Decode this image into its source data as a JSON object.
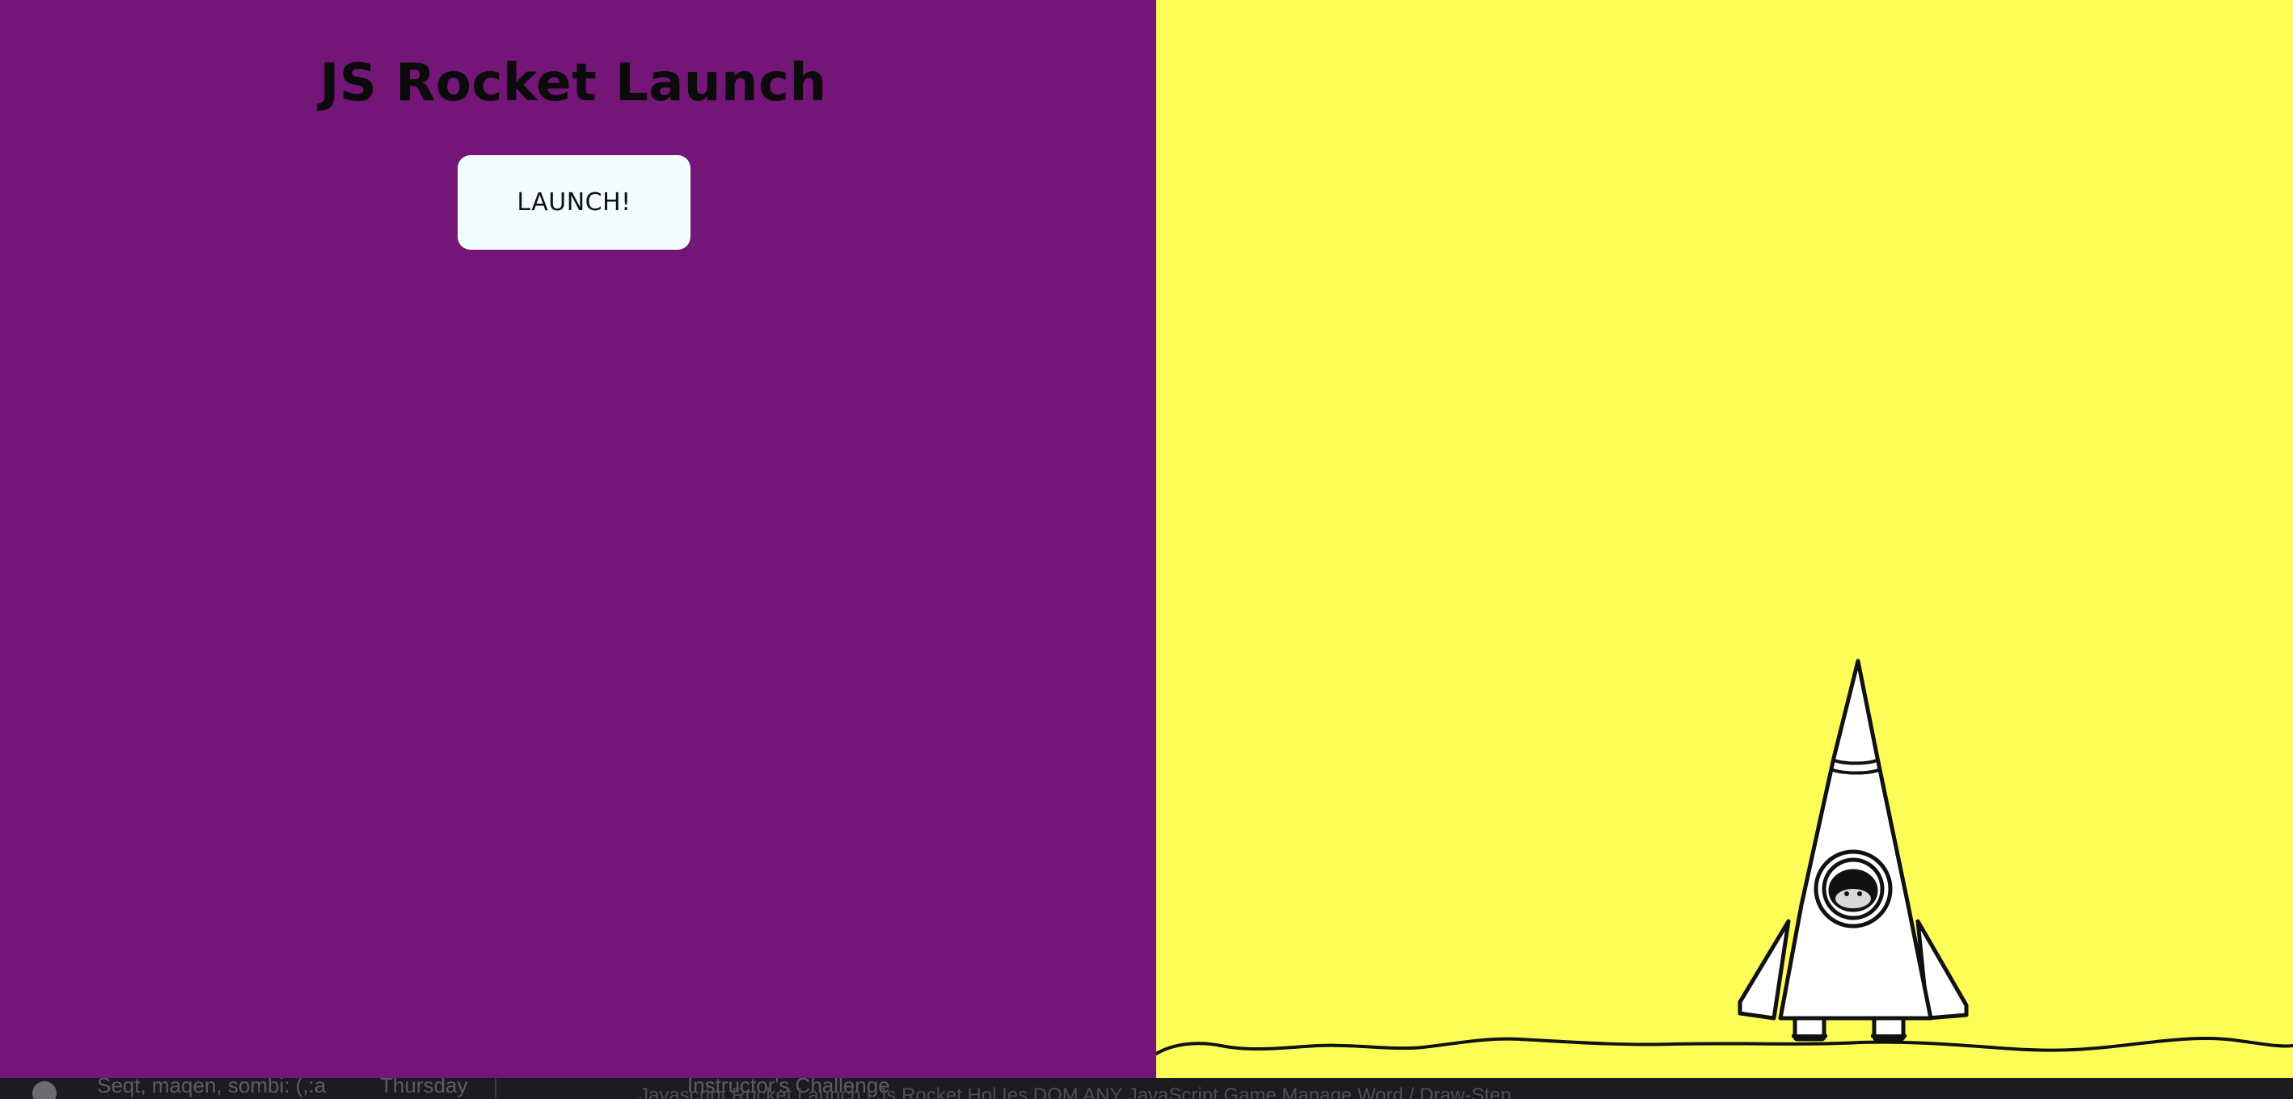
{
  "page": {
    "title": "JS Rocket Launch",
    "launch_button_label": "LAUNCH!"
  },
  "colors": {
    "left_background": "#741677",
    "right_background": "#fdfd57",
    "button_background": "#f2fdff",
    "title_color": "#0b0b0b"
  },
  "icons": {
    "rocket": "rocket-illustration",
    "ground": "ground-line"
  },
  "taskbar": {
    "item1": "Seqt, maqen, sombi: (,:a",
    "item2": "Thursday",
    "item3": "Instructor's Challenge",
    "item4": "Javascript Rocket Launch | Js Rocket  Hol  Ies  DOM  ANY  JavaScript Game  Manage Word / Draw-Step"
  }
}
